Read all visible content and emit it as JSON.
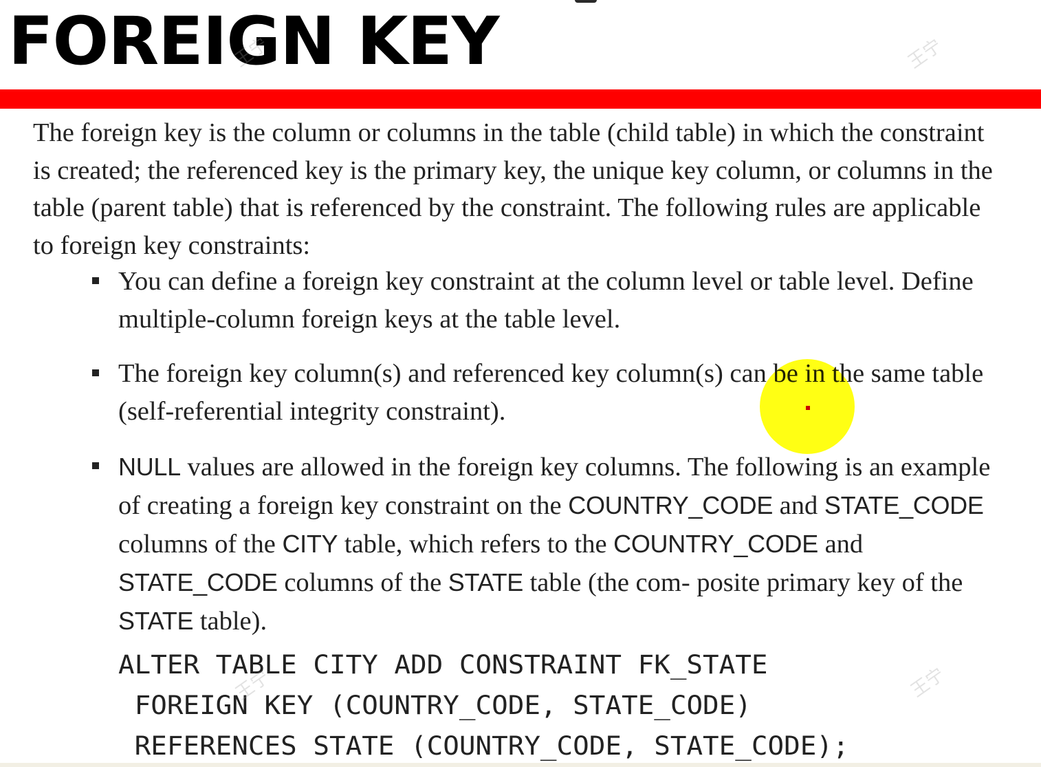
{
  "slide": {
    "title": "FOREIGN KEY",
    "intro": "The foreign key is the column or columns in the table (child table) in which the constraint is created; the referenced key is the primary key, the unique key column, or columns in the table (parent table) that is referenced by the constraint. The following rules are applicable to foreign key constraints:",
    "bullets": [
      {
        "text": "You can define a foreign key constraint at the column level or table level. Define multiple-column foreign keys at the table level."
      },
      {
        "text": "The foreign key column(s) and referenced key column(s) can be in the same table (self-referential integrity constraint)."
      },
      {
        "parts": [
          "NULL",
          " values are allowed in the foreign key columns. The following is an example of creating a foreign key constraint on the ",
          "COUNTRY_CODE",
          " and ",
          "STATE_CODE",
          " columns of the ",
          "CITY",
          " table, which refers to the ",
          "COUNTRY_CODE",
          " and ",
          "STATE_CODE",
          " columns of the ",
          "STATE",
          " table (the com- posite primary key of the ",
          "STATE",
          " table)."
        ]
      }
    ],
    "code_lines": [
      "ALTER TABLE CITY ADD CONSTRAINT FK_STATE",
      "FOREIGN KEY (COUNTRY_CODE, STATE_CODE)",
      "REFERENCES STATE (COUNTRY_CODE, STATE_CODE);"
    ],
    "watermark": "王宁"
  },
  "colors": {
    "title_bar": "#ff0000",
    "text": "#222222",
    "cursor_highlight": "#ffff00"
  }
}
